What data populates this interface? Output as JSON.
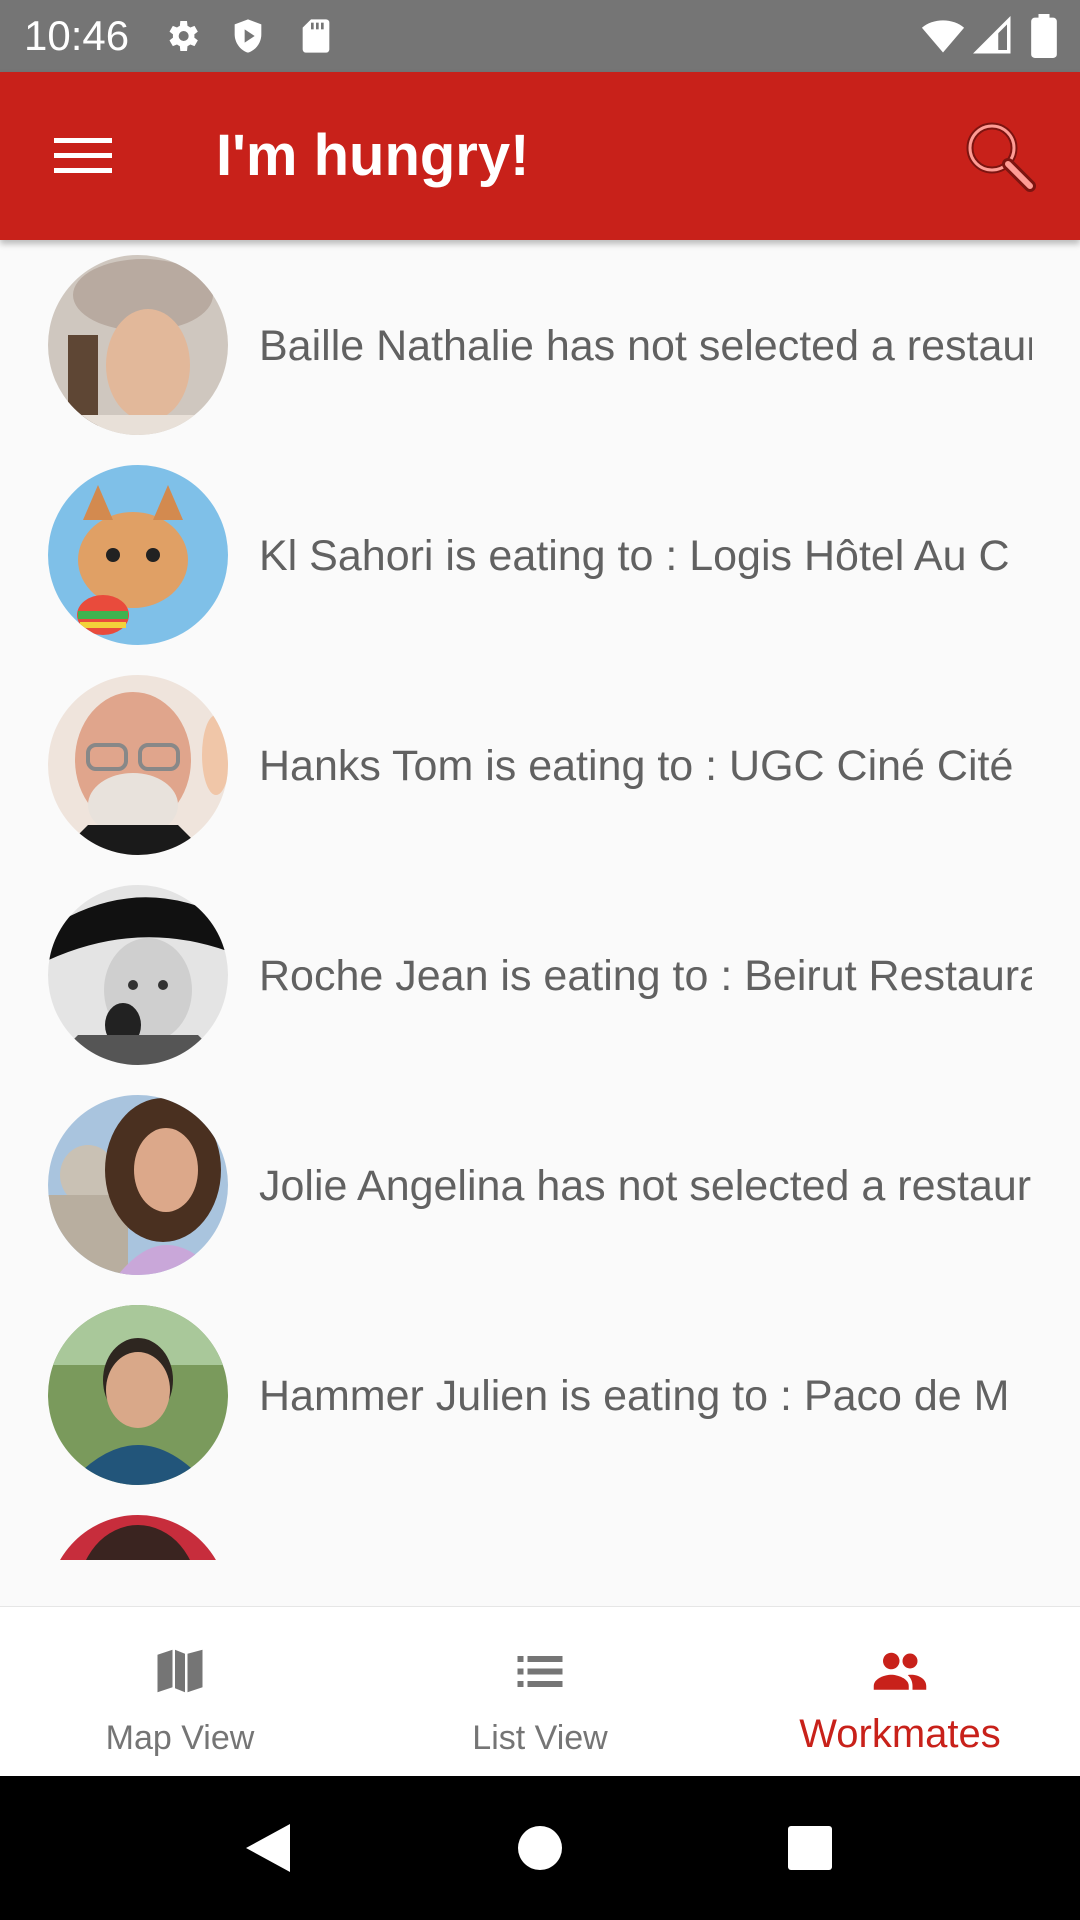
{
  "status_bar": {
    "time": "10:46",
    "icons": [
      "gear-icon",
      "shield-icon",
      "sd-card-icon",
      "wifi-icon",
      "cell-signal-icon",
      "battery-icon"
    ]
  },
  "app_bar": {
    "title": "I'm hungry!",
    "color": "#c8211a",
    "menu_icon": "hamburger-menu-icon",
    "search_icon": "magnifier-search-icon"
  },
  "workmates": [
    {
      "text": "Baille Nathalie has not selected a restaurant yet"
    },
    {
      "text": "Kl Sahori is eating to : Logis Hôtel Au C"
    },
    {
      "text": "Hanks Tom is eating to : UGC Ciné Cité"
    },
    {
      "text": "Roche Jean is eating to : Beirut Restaurant"
    },
    {
      "text": "Jolie Angelina has not selected a restaurant yet"
    },
    {
      "text": "Hammer Julien is eating to : Paco de M"
    }
  ],
  "bottom_nav": {
    "tabs": [
      {
        "label": "Map View",
        "icon": "map-icon",
        "active": false
      },
      {
        "label": "List View",
        "icon": "list-icon",
        "active": false
      },
      {
        "label": "Workmates",
        "icon": "people-icon",
        "active": true
      }
    ],
    "active_color": "#c8211a",
    "inactive_color": "#757575"
  },
  "system_nav": {
    "icons": [
      "back-icon",
      "home-icon",
      "recents-icon"
    ]
  }
}
